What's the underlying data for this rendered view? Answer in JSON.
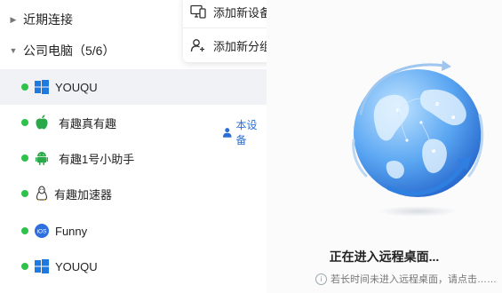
{
  "device_list": {
    "recent_group_label": "近期连接",
    "company_group_label": "公司电脑（5/6）",
    "devices": [
      {
        "name": "YOUQU",
        "os_icon": "windows-icon"
      },
      {
        "name": "有趣真有趣",
        "os_icon": "apple-icon"
      },
      {
        "name": "有趣1号小助手",
        "os_icon": "android-icon"
      },
      {
        "name": "有趣加速器",
        "os_icon": "linux-icon"
      },
      {
        "name": "Funny",
        "os_icon": "ios-icon"
      },
      {
        "name": "YOUQU",
        "os_icon": "windows-icon"
      }
    ],
    "this_device_label": "本设备"
  },
  "context_menu": {
    "add_device_label": "添加新设备",
    "add_group_label": "添加新分组"
  },
  "connect_panel": {
    "status_text": "正在进入远程桌面...",
    "hint_text": "若长时间未进入远程桌面，请点击……"
  },
  "colors": {
    "online": "#2ec24b",
    "accent": "#2b6fd6"
  }
}
